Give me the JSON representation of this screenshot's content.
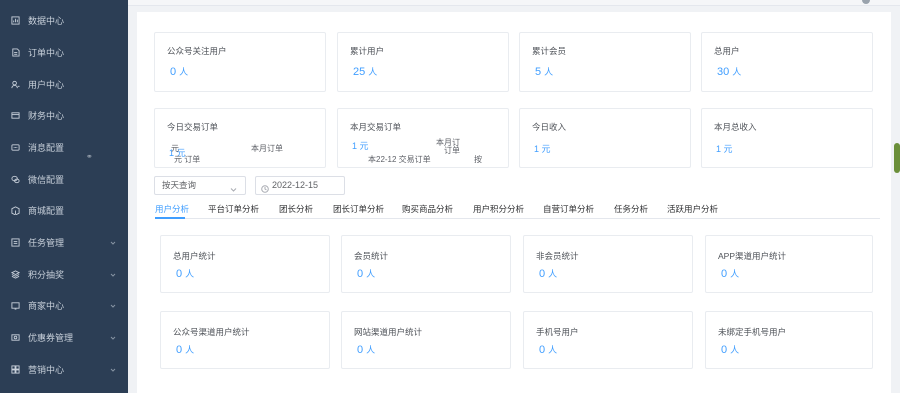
{
  "sidebar": {
    "items": [
      {
        "label": "数据中心",
        "icon": "data-icon",
        "chevron": false
      },
      {
        "label": "订单中心",
        "icon": "order-icon",
        "chevron": false
      },
      {
        "label": "用户中心",
        "icon": "user-icon",
        "chevron": false
      },
      {
        "label": "财务中心",
        "icon": "finance-icon",
        "chevron": false
      },
      {
        "label": "消息配置",
        "icon": "message-icon",
        "chevron": false
      },
      {
        "label": "微信配置",
        "icon": "wechat-icon",
        "chevron": false
      },
      {
        "label": "商城配置",
        "icon": "store-icon",
        "chevron": false
      },
      {
        "label": "任务管理",
        "icon": "task-icon",
        "chevron": true
      },
      {
        "label": "积分抽奖",
        "icon": "lottery-icon",
        "chevron": true
      },
      {
        "label": "商家中心",
        "icon": "merchant-icon",
        "chevron": true
      },
      {
        "label": "优惠券管理",
        "icon": "coupon-icon",
        "chevron": true
      },
      {
        "label": "营销中心",
        "icon": "marketing-icon",
        "chevron": true
      }
    ]
  },
  "overview": {
    "row1": [
      {
        "label": "公众号关注用户",
        "value": "0",
        "unit": "人"
      },
      {
        "label": "累计用户",
        "value": "25",
        "unit": "人"
      },
      {
        "label": "累计会员",
        "value": "5",
        "unit": "人"
      },
      {
        "label": "总用户",
        "value": "30",
        "unit": "人"
      }
    ],
    "row2": [
      {
        "label": "今日交易订单",
        "value": "1",
        "unit": "元"
      },
      {
        "label": "本月交易订单",
        "value": "1",
        "unit": "元"
      },
      {
        "label": "今日收入",
        "value": "1",
        "unit": "元"
      },
      {
        "label": "本月总收入",
        "value": "1",
        "unit": "元"
      }
    ],
    "ghost": {
      "a": "元",
      "b": "本月订单",
      "c": "元 订单",
      "d": "本月订",
      "e": "订单",
      "f": "本22-12 交易订单",
      "g": "按",
      "h": "本月",
      "i": "订单"
    }
  },
  "filters": {
    "query_type": "按天查询",
    "date": "2022-12-15"
  },
  "tabs": [
    "用户分析",
    "平台订单分析",
    "团长分析",
    "团长订单分析",
    "购买商品分析",
    "用户积分分析",
    "自营订单分析",
    "任务分析",
    "活跃用户分析"
  ],
  "user_stats": {
    "row1": [
      {
        "label": "总用户统计",
        "value": "0",
        "unit": "人"
      },
      {
        "label": "会员统计",
        "value": "0",
        "unit": "人"
      },
      {
        "label": "非会员统计",
        "value": "0",
        "unit": "人"
      },
      {
        "label": "APP渠道用户统计",
        "value": "0",
        "unit": "人"
      }
    ],
    "row2": [
      {
        "label": "公众号渠道用户统计",
        "value": "0",
        "unit": "人"
      },
      {
        "label": "网站渠道用户统计",
        "value": "0",
        "unit": "人"
      },
      {
        "label": "手机号用户",
        "value": "0",
        "unit": "人"
      },
      {
        "label": "未绑定手机号用户",
        "value": "0",
        "unit": "人"
      }
    ]
  },
  "colors": {
    "sidebar": "#2c3e55",
    "accent": "#409eff"
  }
}
